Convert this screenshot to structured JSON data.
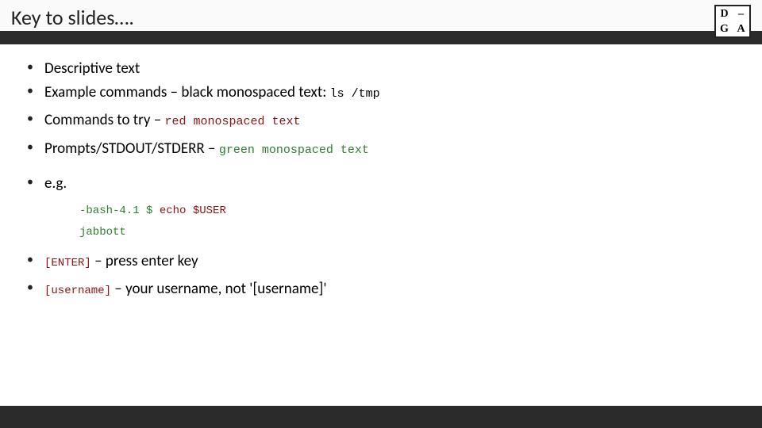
{
  "title": "Key to slides….",
  "logo": {
    "tl": "D",
    "tr": "–",
    "bl": "G",
    "br": "A"
  },
  "bullets": {
    "b1": "Descriptive text",
    "b2_prefix": "Example commands – black monospaced text: ",
    "b2_code": "ls /tmp",
    "b3_prefix": "Commands to try – ",
    "b3_code": "red monospaced text",
    "b4_prefix": "Prompts/STDOUT/STDERR – ",
    "b4_code": "green monospaced text",
    "b5": "e.g.",
    "b6_code": "[ENTER]",
    "b6_suffix": " – press enter key",
    "b7_code": "[username]",
    "b7_suffix": " – your username, not '[username]'"
  },
  "example": {
    "prompt": "-bash-4.1 $ ",
    "cmd": "echo $USER",
    "out": "jabbott"
  }
}
